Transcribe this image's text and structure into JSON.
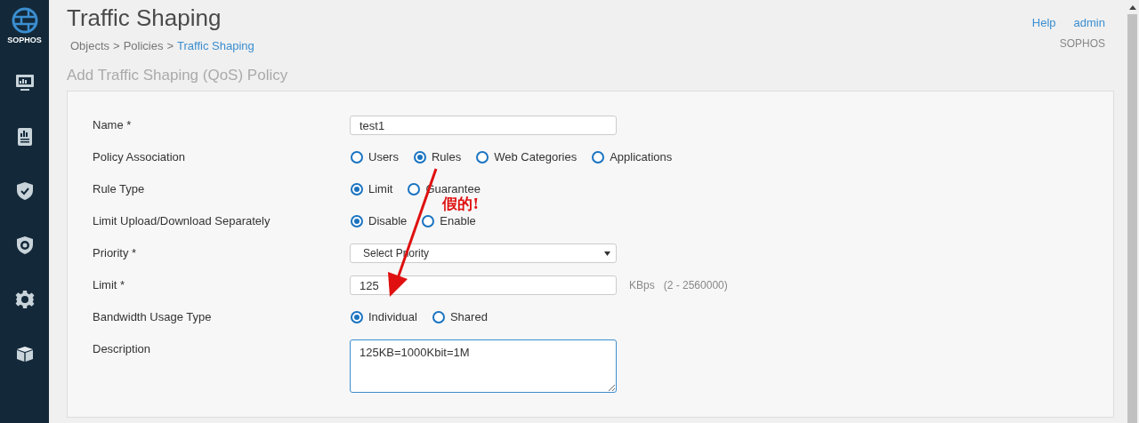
{
  "sidebar": {
    "brand": "SOPHOS",
    "items": [
      {
        "kind": "monitor"
      },
      {
        "kind": "report"
      },
      {
        "kind": "shield"
      },
      {
        "kind": "badge"
      },
      {
        "kind": "gear"
      },
      {
        "kind": "box"
      }
    ]
  },
  "header": {
    "title": "Traffic Shaping",
    "breadcrumb": [
      "Objects",
      "Policies",
      "Traffic Shaping"
    ],
    "breadcrumb_separator": ">",
    "links": [
      "Help",
      "admin"
    ],
    "company": "SOPHOS"
  },
  "section_title": "Add Traffic Shaping (QoS) Policy",
  "form": [
    {
      "kind": "text",
      "label": "Name *",
      "value": "test1"
    },
    {
      "kind": "radio",
      "label": "Policy Association",
      "options": [
        {
          "label": "Users",
          "selected": false
        },
        {
          "label": "Rules",
          "selected": true
        },
        {
          "label": "Web Categories",
          "selected": false
        },
        {
          "label": "Applications",
          "selected": false
        }
      ]
    },
    {
      "kind": "radio",
      "label": "Rule Type",
      "options": [
        {
          "label": "Limit",
          "selected": true
        },
        {
          "label": "Guarantee",
          "selected": false
        }
      ]
    },
    {
      "kind": "radio",
      "label": "Limit Upload/Download Separately",
      "options": [
        {
          "label": "Disable",
          "selected": true
        },
        {
          "label": "Enable",
          "selected": false
        }
      ]
    },
    {
      "kind": "select",
      "label": "Priority *",
      "value": "Select Priority"
    },
    {
      "kind": "text",
      "label": "Limit *",
      "value": "125",
      "unit": "KBps",
      "range": "(2 - 2560000)"
    },
    {
      "kind": "radio",
      "label": "Bandwidth Usage Type",
      "options": [
        {
          "label": "Individual",
          "selected": true
        },
        {
          "label": "Shared",
          "selected": false
        }
      ]
    },
    {
      "kind": "textarea",
      "label": "Description",
      "value": "125KB=1000Kbit=1M"
    }
  ],
  "annotation": {
    "text": "假的!"
  }
}
